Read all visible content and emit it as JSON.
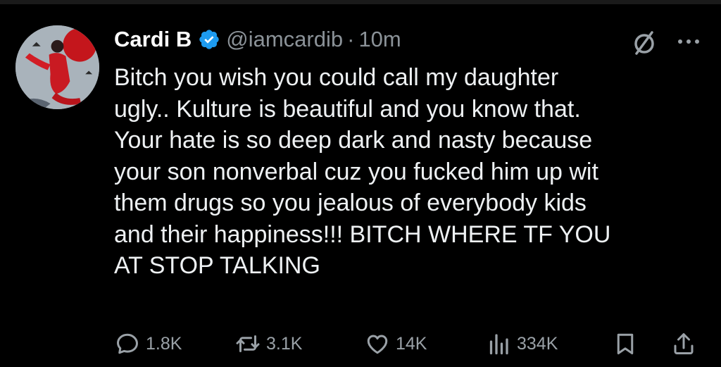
{
  "tweet": {
    "author_name": "Cardi B",
    "handle": "@iamcardib",
    "separator": "·",
    "time": "10m",
    "text": "Bitch you wish you could call my daughter\nugly.. Kulture is beautiful and you know that.\nYour hate is so deep dark and nasty because\nyour son nonverbal cuz you fucked him up wit\nthem drugs so you jealous of everybody kids\nand their happiness!!! BITCH WHERE TF YOU\nAT STOP TALKING"
  },
  "actions": {
    "replies": "1.8K",
    "reposts": "3.1K",
    "likes": "14K",
    "views": "334K"
  },
  "icons": {
    "verified": "verified-badge-icon",
    "grok": "grok-icon",
    "more": "more-icon",
    "reply": "reply-icon",
    "repost": "repost-icon",
    "like": "heart-icon",
    "views": "views-icon",
    "bookmark": "bookmark-icon",
    "share": "share-icon"
  },
  "colors": {
    "background": "#000000",
    "text": "#e7e9ea",
    "secondary": "#8b9298",
    "verified": "#1d9bf0"
  }
}
